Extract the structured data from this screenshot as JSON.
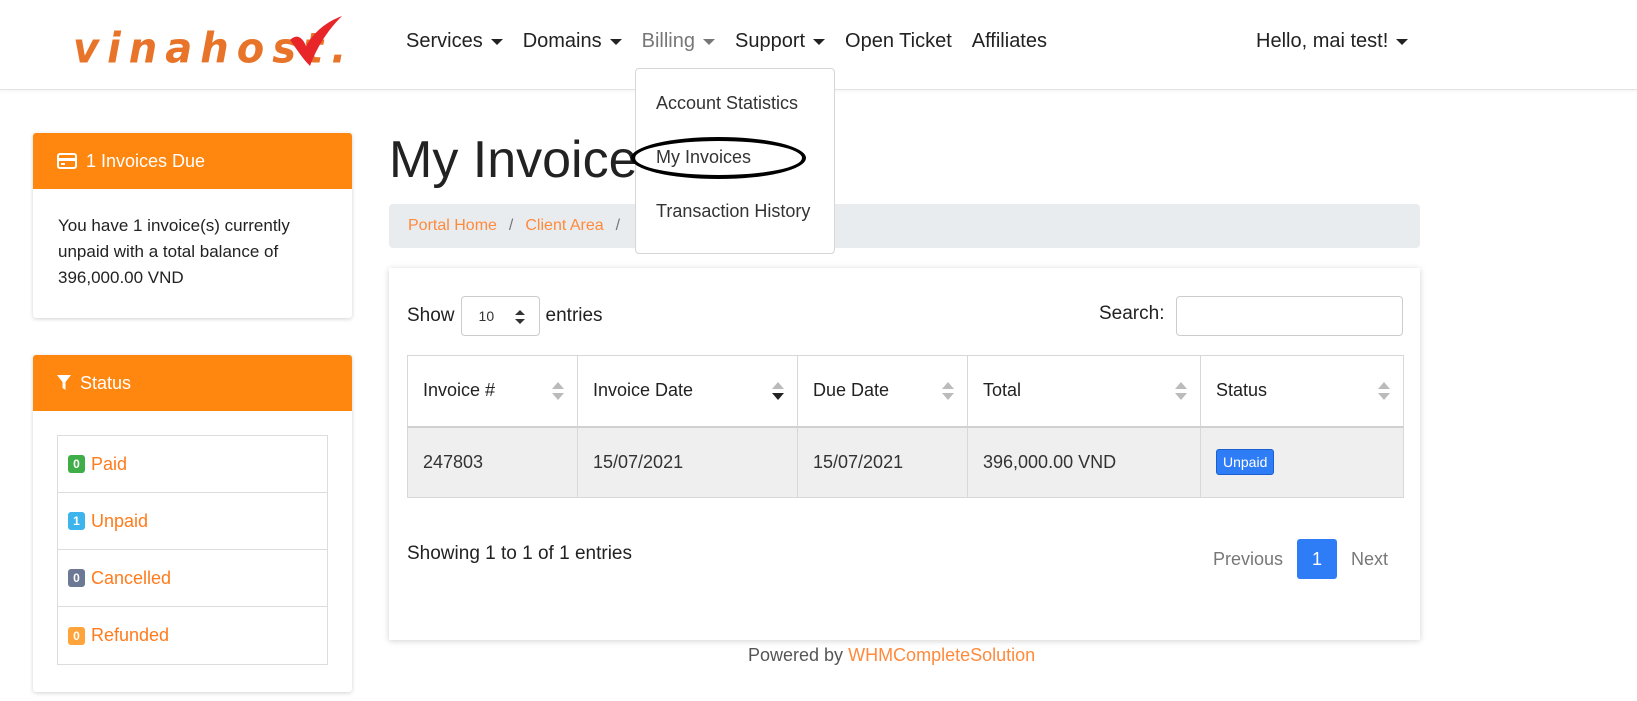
{
  "brand": {
    "logo_text": "vinahost.",
    "accent": "#ff870f",
    "link_color": "#ff8a3c",
    "primary_blue": "#2f7df6"
  },
  "nav": {
    "items": [
      {
        "label": "Services",
        "has_caret": true
      },
      {
        "label": "Domains",
        "has_caret": true
      },
      {
        "label": "Billing",
        "has_caret": true,
        "active": true
      },
      {
        "label": "Support",
        "has_caret": true
      },
      {
        "label": "Open Ticket",
        "has_caret": false
      },
      {
        "label": "Affiliates",
        "has_caret": false
      }
    ],
    "user_label": "Hello, mai test!"
  },
  "billing_menu": {
    "items": [
      "Account Statistics",
      "My Invoices",
      "Transaction History"
    ],
    "highlighted": "My Invoices"
  },
  "invoices_due_panel": {
    "title": "1 Invoices Due",
    "icon": "credit-card-icon",
    "body": "You have 1 invoice(s) currently unpaid with a total balance of 396,000.00 VND"
  },
  "status_panel": {
    "title": "Status",
    "icon": "filter-icon",
    "items": [
      {
        "count": "0",
        "label": "Paid",
        "color": "#3fae49"
      },
      {
        "count": "1",
        "label": "Unpaid",
        "color": "#3db5ec"
      },
      {
        "count": "0",
        "label": "Cancelled",
        "color": "#6c7894"
      },
      {
        "count": "0",
        "label": "Refunded",
        "color": "#ffa43a"
      }
    ]
  },
  "page": {
    "title": "My Invoices",
    "breadcrumb": [
      "Portal Home",
      "Client Area"
    ]
  },
  "table_controls": {
    "show_label": "Show",
    "entries_value": "10",
    "entries_label": "entries",
    "search_label": "Search:",
    "search_value": ""
  },
  "table": {
    "columns": [
      "Invoice #",
      "Invoice Date",
      "Due Date",
      "Total",
      "Status"
    ],
    "rows": [
      {
        "invoice": "247803",
        "invoice_date": "15/07/2021",
        "due_date": "15/07/2021",
        "total": "396,000.00 VND",
        "status": "Unpaid"
      }
    ]
  },
  "pagination": {
    "info": "Showing 1 to 1 of 1 entries",
    "previous": "Previous",
    "current": "1",
    "next": "Next"
  },
  "footer": {
    "prefix": "Powered by",
    "link": "WHMCompleteSolution"
  }
}
